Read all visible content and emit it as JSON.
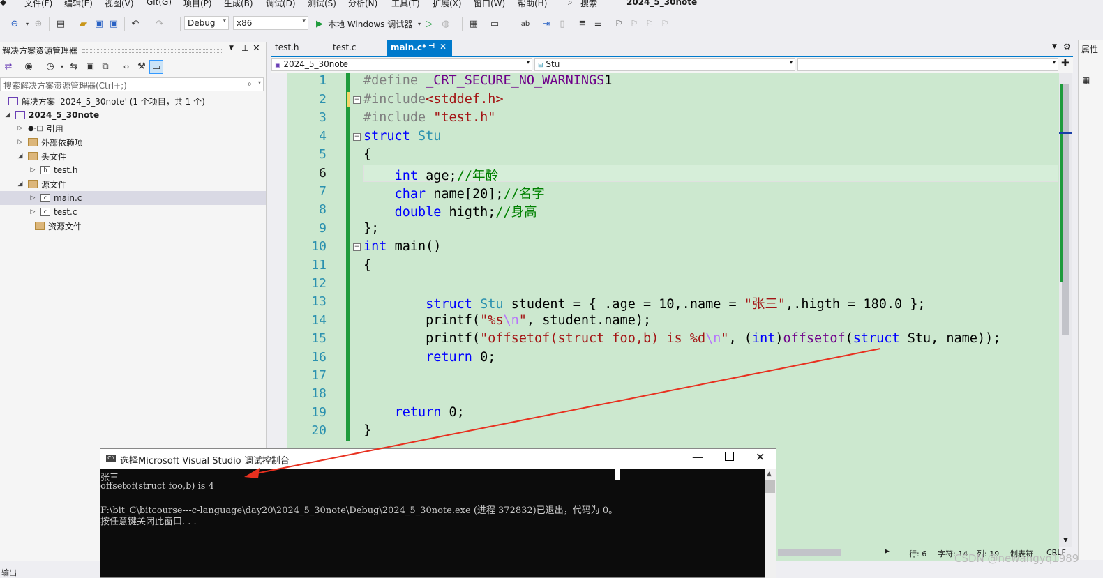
{
  "menu": [
    "文件(F)",
    "编辑(E)",
    "视图(V)",
    "Git(G)",
    "项目(P)",
    "生成(B)",
    "调试(D)",
    "测试(S)",
    "分析(N)",
    "工具(T)",
    "扩展(X)",
    "窗口(W)",
    "帮助(H)",
    "搜索",
    "2024_5_30note"
  ],
  "toolbar": {
    "config": "Debug",
    "platform": "x86",
    "run_label": "本地 Windows 调试器"
  },
  "solution_explorer": {
    "title": "解决方案资源管理器",
    "search_placeholder": "搜索解决方案资源管理器(Ctrl+;)",
    "tree": [
      {
        "label": "解决方案 '2024_5_30note' (1 个项目，共 1 个)"
      },
      {
        "label": "2024_5_30note"
      },
      {
        "label": "引用"
      },
      {
        "label": "外部依赖项"
      },
      {
        "label": "头文件"
      },
      {
        "label": "test.h"
      },
      {
        "label": "源文件"
      },
      {
        "label": "main.c"
      },
      {
        "label": "test.c"
      },
      {
        "label": "资源文件"
      }
    ]
  },
  "tabs": [
    {
      "label": "test.h"
    },
    {
      "label": "test.c"
    },
    {
      "label": "main.c*"
    }
  ],
  "nav": {
    "project": "2024_5_30note",
    "scope": "Stu"
  },
  "editor": {
    "line_numbers": [
      "1",
      "2",
      "3",
      "4",
      "5",
      "6",
      "7",
      "8",
      "9",
      "10",
      "11",
      "12",
      "13",
      "14",
      "15",
      "16",
      "17",
      "18",
      "19",
      "20"
    ],
    "current_line": 6
  },
  "status_bar": {
    "line": "行: 6",
    "char": "字符: 14",
    "col": "列: 19",
    "tab": "制表符",
    "eol": "CRLF"
  },
  "console": {
    "title": "选择Microsoft Visual Studio 调试控制台",
    "lines": [
      "张三",
      "offsetof(struct foo,b) is 4",
      "",
      "F:\\bit_C\\bitcourse---c-language\\day20\\2024_5_30note\\Debug\\2024_5_30note.exe (进程 372832)已退出，代码为 0。",
      "按任意键关闭此窗口. . ."
    ]
  },
  "watermark": "CSDN @newangyq1989",
  "colors": {
    "accent": "#007acc",
    "editor_bg": "#cce8cf",
    "console_bg": "#0c0c0c",
    "arrow": "#e8301f"
  }
}
